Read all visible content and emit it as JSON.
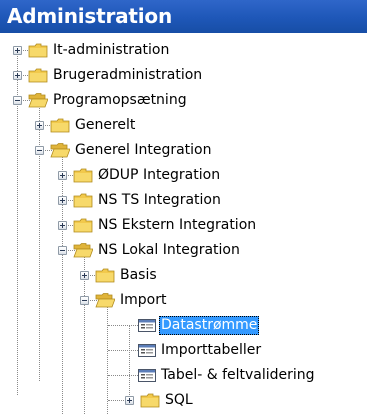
{
  "header": {
    "title": "Administration",
    "background_color": "#1e57b8"
  },
  "tree": {
    "items": [
      {
        "label": "It-administration",
        "type": "folder",
        "expander": "plus"
      },
      {
        "label": "Brugeradministration",
        "type": "folder",
        "expander": "plus"
      },
      {
        "label": "Programopsætning",
        "type": "folder-open",
        "expander": "minus"
      },
      {
        "label": "Generelt",
        "type": "folder",
        "expander": "plus"
      },
      {
        "label": "Generel Integration",
        "type": "folder-open",
        "expander": "minus"
      },
      {
        "label": "ØDUP Integration",
        "type": "folder",
        "expander": "plus"
      },
      {
        "label": "NS TS Integration",
        "type": "folder",
        "expander": "plus"
      },
      {
        "label": "NS Ekstern Integration",
        "type": "folder",
        "expander": "plus"
      },
      {
        "label": "NS Lokal Integration",
        "type": "folder-open",
        "expander": "minus"
      },
      {
        "label": "Basis",
        "type": "folder",
        "expander": "plus"
      },
      {
        "label": "Import",
        "type": "folder-open",
        "expander": "minus"
      },
      {
        "label": "Datastrømme",
        "type": "form",
        "selected": true
      },
      {
        "label": "Importtabeller",
        "type": "form"
      },
      {
        "label": "Tabel- & feltvalidering",
        "type": "form"
      },
      {
        "label": "SQL",
        "type": "folder",
        "expander": "plus"
      }
    ]
  },
  "colors": {
    "selection": "#3399ff",
    "folder": "#f2c94c"
  }
}
